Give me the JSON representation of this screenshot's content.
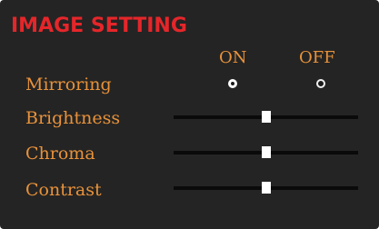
{
  "title": "IMAGE SETTING",
  "columns": {
    "on": "ON",
    "off": "OFF"
  },
  "mirroring": {
    "label": "Mirroring",
    "selected": "ON"
  },
  "sliders": {
    "brightness": {
      "label": "Brightness",
      "value": 0.5
    },
    "chroma": {
      "label": "Chroma",
      "value": 0.5
    },
    "contrast": {
      "label": "Contrast",
      "value": 0.5
    }
  },
  "colors": {
    "title": "#e5262a",
    "label": "#e8923a",
    "panel": "#242424",
    "track": "#0a0a0a",
    "thumb": "#ffffff"
  }
}
